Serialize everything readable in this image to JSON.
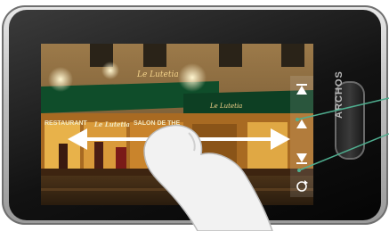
{
  "device": {
    "brand": "ARCHOS"
  },
  "screen": {
    "sign_top": "Le Lutetia",
    "sign_awning": "Le Lutetia",
    "awning_left": "RESTAURANT",
    "awning_middle": "Le Lutetia",
    "awning_right": "SALON DE THE"
  },
  "controls": {
    "icons": [
      "skip-forward-icon",
      "play-icon",
      "skip-back-icon",
      "repeat-icon"
    ]
  },
  "colors": {
    "frame": "#bdbdbd",
    "bezel": "#121212",
    "callout_line": "#4fae8f",
    "awning_green": "#0f4d2a"
  }
}
